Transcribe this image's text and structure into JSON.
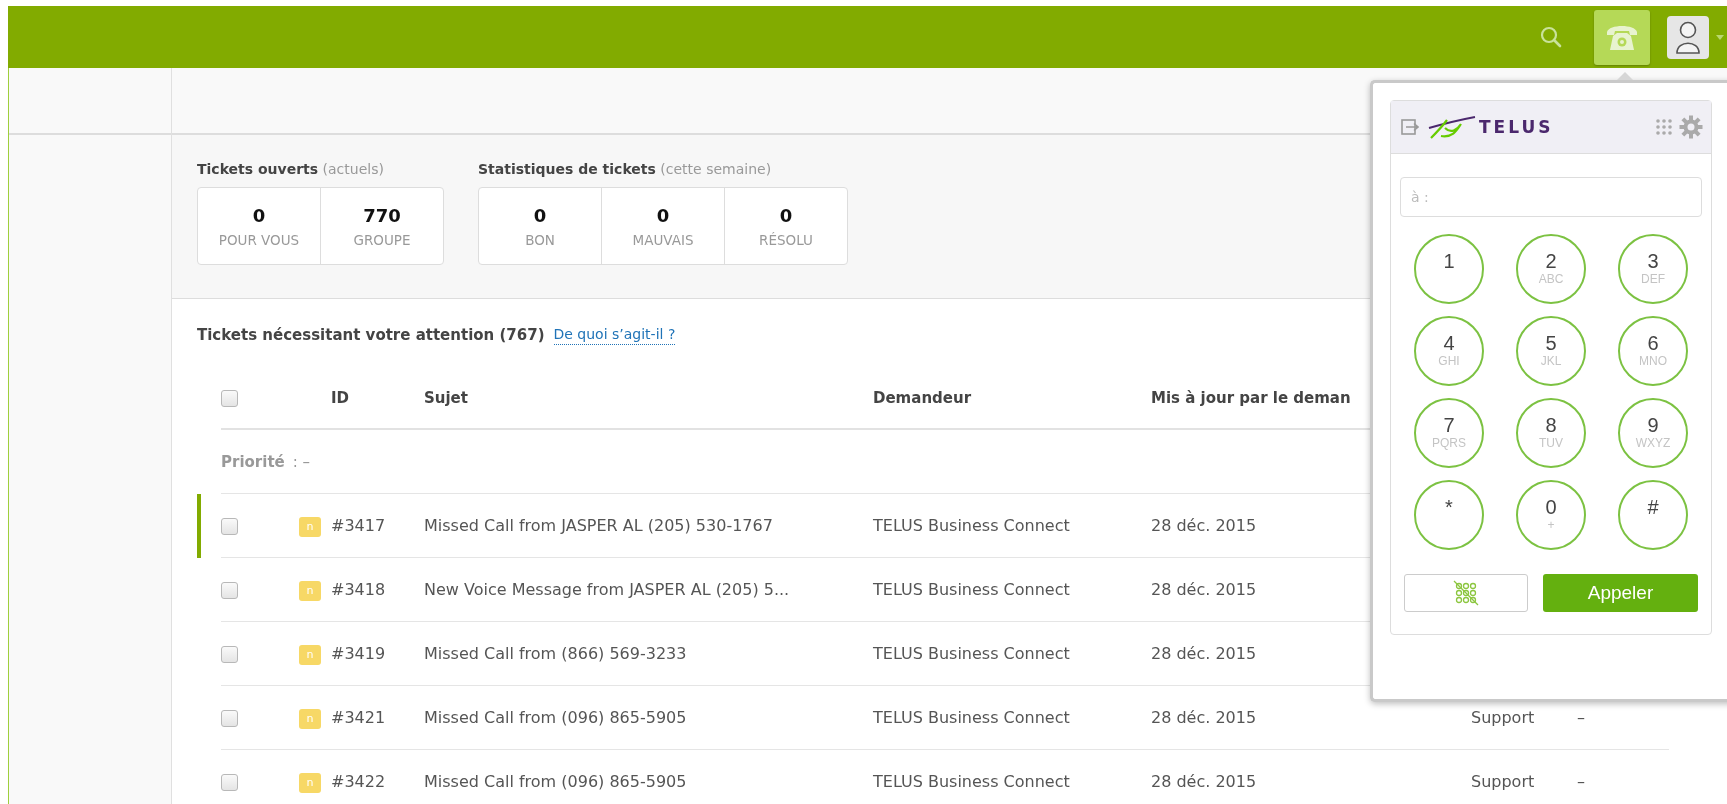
{
  "toolbar": [
    {
      "kind": "search",
      "selected": false
    },
    {
      "kind": "phone",
      "selected": true
    },
    {
      "kind": "avatar",
      "selected": false
    }
  ],
  "stats": [
    {
      "title": "Tickets ouverts",
      "note": "(actuels)",
      "cells": [
        {
          "value": "0",
          "label": "POUR VOUS"
        },
        {
          "value": "770",
          "label": "GROUPE"
        }
      ]
    },
    {
      "title": "Statistiques de tickets",
      "note": "(cette semaine)",
      "cells": [
        {
          "value": "0",
          "label": "BON"
        },
        {
          "value": "0",
          "label": "MAUVAIS"
        },
        {
          "value": "0",
          "label": "RÉSOLU"
        }
      ]
    }
  ],
  "attention": {
    "title": "Tickets nécessitant votre attention (767)",
    "link": "De quoi s’agit-il ?"
  },
  "table": {
    "select_all_checked": false,
    "columns": [
      "ID",
      "Sujet",
      "Demandeur",
      "Mis à jour par le deman"
    ],
    "group": {
      "label": "Priorité",
      "value": ": –"
    },
    "rows": [
      {
        "selected": true,
        "checked": false,
        "badge": "n",
        "id": "#3417",
        "subject": "Missed Call from JASPER AL (205) 530-1767",
        "requester": "TELUS Business Connect",
        "updated": "28 déc. 2015"
      },
      {
        "selected": false,
        "checked": false,
        "badge": "n",
        "id": "#3418",
        "subject": "New Voice Message from JASPER AL (205) 5...",
        "requester": "TELUS Business Connect",
        "updated": "28 déc. 2015"
      },
      {
        "selected": false,
        "checked": false,
        "badge": "n",
        "id": "#3419",
        "subject": "Missed Call from (866) 569-3233",
        "requester": "TELUS Business Connect",
        "updated": "28 déc. 2015"
      },
      {
        "selected": false,
        "checked": false,
        "badge": "n",
        "id": "#3421",
        "subject": "Missed Call from (096) 865-5905",
        "requester": "TELUS Business Connect",
        "updated": "28 déc. 2015",
        "column_5": "Support",
        "column_6": "–"
      },
      {
        "selected": false,
        "checked": false,
        "badge": "n",
        "id": "#3422",
        "subject": "Missed Call from (096) 865-5905",
        "requester": "TELUS Business Connect",
        "updated": "28 déc. 2015",
        "column_5": "Support",
        "column_6": "–"
      }
    ]
  },
  "dialer": {
    "brand": "TELUS",
    "placeholder": "à :",
    "keys": [
      {
        "digit": "1"
      },
      {
        "digit": "2",
        "letters": "ABC"
      },
      {
        "digit": "3",
        "letters": "DEF"
      },
      {
        "digit": "4",
        "letters": "GHI"
      },
      {
        "digit": "5",
        "letters": "JKL"
      },
      {
        "digit": "6",
        "letters": "MNO"
      },
      {
        "digit": "7",
        "letters": "PQRS"
      },
      {
        "digit": "8",
        "letters": "TUV"
      },
      {
        "digit": "9",
        "letters": "WXYZ"
      },
      {
        "digit": "*"
      },
      {
        "digit": "0",
        "letters": "+"
      },
      {
        "digit": "#"
      }
    ],
    "call_button": "Appeler"
  }
}
